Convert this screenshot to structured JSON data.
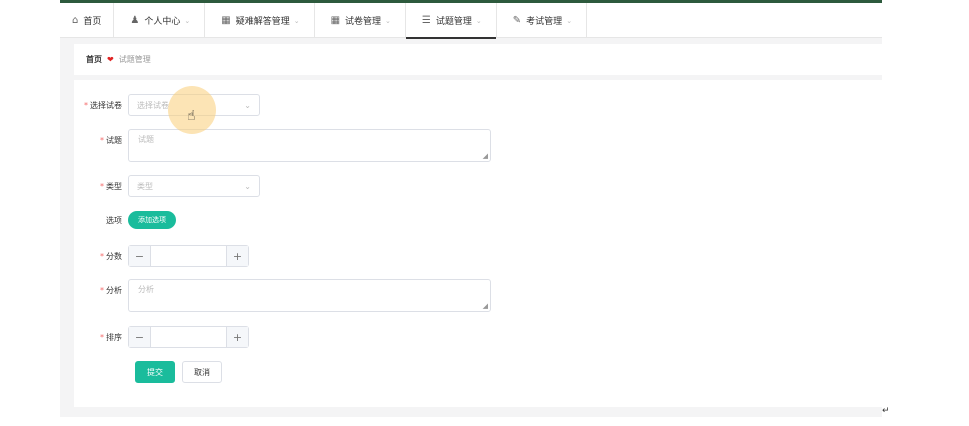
{
  "nav": {
    "items": [
      {
        "icon": "home-icon",
        "glyph": "⌂",
        "label": "首页",
        "chevron": ""
      },
      {
        "icon": "user-icon",
        "glyph": "♟",
        "label": "个人中心",
        "chevron": "⌄"
      },
      {
        "icon": "qa-icon",
        "glyph": "▦",
        "label": "疑难解答管理",
        "chevron": "⌄"
      },
      {
        "icon": "grid-icon",
        "glyph": "▦",
        "label": "试卷管理",
        "chevron": "⌄"
      },
      {
        "icon": "list-icon",
        "glyph": "☰",
        "label": "试题管理",
        "chevron": "⌄"
      },
      {
        "icon": "exam-icon",
        "glyph": "✎",
        "label": "考试管理",
        "chevron": "⌄"
      }
    ]
  },
  "breadcrumb": {
    "home": "首页",
    "separator": "❤",
    "current": "试题管理"
  },
  "form": {
    "paper": {
      "label": "选择试卷",
      "required": "*",
      "placeholder": "选择试卷",
      "chevron": "⌄"
    },
    "question": {
      "label": "试题",
      "required": "*",
      "placeholder": "试题"
    },
    "type": {
      "label": "类型",
      "required": "*",
      "placeholder": "类型",
      "chevron": "⌄"
    },
    "options": {
      "label": "选项",
      "button": "添加选项"
    },
    "score": {
      "label": "分数",
      "required": "*",
      "minus": "−",
      "plus": "+"
    },
    "analysis": {
      "label": "分析",
      "required": "*",
      "placeholder": "分析"
    },
    "sort": {
      "label": "排序",
      "required": "*",
      "minus": "−",
      "plus": "+"
    },
    "submit": "提交",
    "cancel": "取消",
    "resize_glyph": "◢"
  },
  "overlay": {
    "cursor_glyph": "☝",
    "return_mark": "↵"
  },
  "colors": {
    "accent": "#1abc9c",
    "required": "#f56c6c",
    "topline": "#2d5a3d"
  }
}
